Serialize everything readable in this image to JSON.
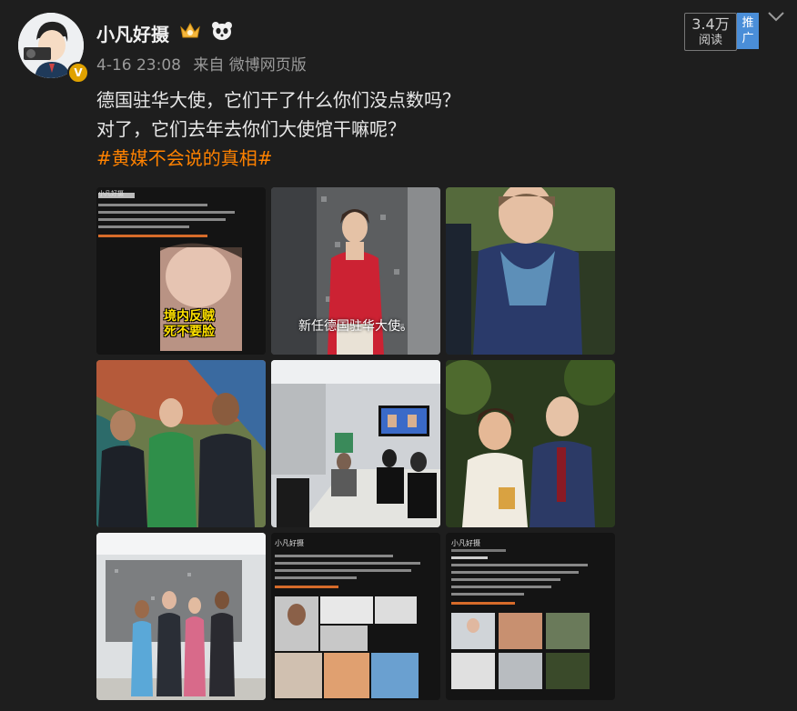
{
  "author": {
    "name": "小凡好摄",
    "badges": [
      "crown-icon",
      "panda-icon"
    ],
    "verified": "V"
  },
  "meta": {
    "time": "4-16 23:08",
    "source": "来自 微博网页版"
  },
  "stats": {
    "reads": "3.4万",
    "reads_label": "阅读",
    "promote_label": "推广"
  },
  "post": {
    "line1": "德国驻华大使，它们干了什么你们没点数吗？",
    "line2": "对了，它们去年去你们大使馆干嘛呢？",
    "hashtag": "#黄媒不会说的真相#"
  },
  "images": {
    "img1": {
      "username": "小凡好摄",
      "highlight": "境内反贼死不要脸"
    },
    "img2": {
      "subtitle": "新任德国驻华大使。"
    },
    "img8": {
      "username": "小凡好摄"
    },
    "img9": {
      "username": "小凡好摄"
    }
  },
  "colors": {
    "background": "#1e1e1e",
    "hashtag": "#ff8200",
    "promote": "#4a8ed8",
    "verified": "#e0a200"
  }
}
